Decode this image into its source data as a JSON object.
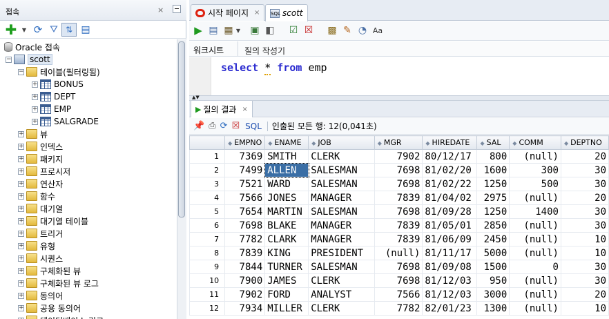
{
  "left_panel": {
    "title": "접속",
    "close_symbol": "×",
    "tree": {
      "root_label": "Oracle 접속",
      "connection_label": "scott",
      "tables_label": "테이블(필터링됨)",
      "tables": [
        "BONUS",
        "DEPT",
        "EMP",
        "SALGRADE"
      ],
      "folders": [
        "뷰",
        "인덱스",
        "패키지",
        "프로시저",
        "연산자",
        "함수",
        "대기열",
        "대기열 테이블",
        "트리거",
        "유형",
        "시퀀스",
        "구체화된 뷰",
        "구체화된 뷰 로그",
        "동의어",
        "공용 동의어",
        "데이터베이스 링크"
      ]
    }
  },
  "editor_tabs": [
    {
      "label": "시작 페이지",
      "close": "×"
    },
    {
      "label": "scott",
      "close": "×"
    }
  ],
  "sub_tabs": {
    "worksheet": "워크시트",
    "query_builder": "질의 작성기"
  },
  "editor": {
    "sql_keyword_select": "select",
    "sql_star": "*",
    "sql_keyword_from": "from",
    "sql_table": "emp"
  },
  "results": {
    "tab_label": "질의 결과",
    "tab_close": "×",
    "sql_link": "SQL",
    "status": "인출된 모든 행: 12(0,041초)",
    "columns": [
      "EMPNO",
      "ENAME",
      "JOB",
      "MGR",
      "HIREDATE",
      "SAL",
      "COMM",
      "DEPTNO"
    ],
    "rows": [
      [
        "1",
        "7369",
        "SMITH",
        "CLERK",
        "7902",
        "80/12/17",
        "800",
        "(null)",
        "20"
      ],
      [
        "2",
        "7499",
        "ALLEN",
        "SALESMAN",
        "7698",
        "81/02/20",
        "1600",
        "300",
        "30"
      ],
      [
        "3",
        "7521",
        "WARD",
        "SALESMAN",
        "7698",
        "81/02/22",
        "1250",
        "500",
        "30"
      ],
      [
        "4",
        "7566",
        "JONES",
        "MANAGER",
        "7839",
        "81/04/02",
        "2975",
        "(null)",
        "20"
      ],
      [
        "5",
        "7654",
        "MARTIN",
        "SALESMAN",
        "7698",
        "81/09/28",
        "1250",
        "1400",
        "30"
      ],
      [
        "6",
        "7698",
        "BLAKE",
        "MANAGER",
        "7839",
        "81/05/01",
        "2850",
        "(null)",
        "30"
      ],
      [
        "7",
        "7782",
        "CLARK",
        "MANAGER",
        "7839",
        "81/06/09",
        "2450",
        "(null)",
        "10"
      ],
      [
        "8",
        "7839",
        "KING",
        "PRESIDENT",
        "(null)",
        "81/11/17",
        "5000",
        "(null)",
        "10"
      ],
      [
        "9",
        "7844",
        "TURNER",
        "SALESMAN",
        "7698",
        "81/09/08",
        "1500",
        "0",
        "30"
      ],
      [
        "10",
        "7900",
        "JAMES",
        "CLERK",
        "7698",
        "81/12/03",
        "950",
        "(null)",
        "30"
      ],
      [
        "11",
        "7902",
        "FORD",
        "ANALYST",
        "7566",
        "81/12/03",
        "3000",
        "(null)",
        "20"
      ],
      [
        "12",
        "7934",
        "MILLER",
        "CLERK",
        "7782",
        "82/01/23",
        "1300",
        "(null)",
        "10"
      ]
    ],
    "selected_cell": {
      "row": 2,
      "column": "ENAME"
    }
  },
  "colors": {
    "keyword": "#2b2bd0",
    "selection": "#3a6ea5",
    "accent_green": "#2a9d2a"
  }
}
